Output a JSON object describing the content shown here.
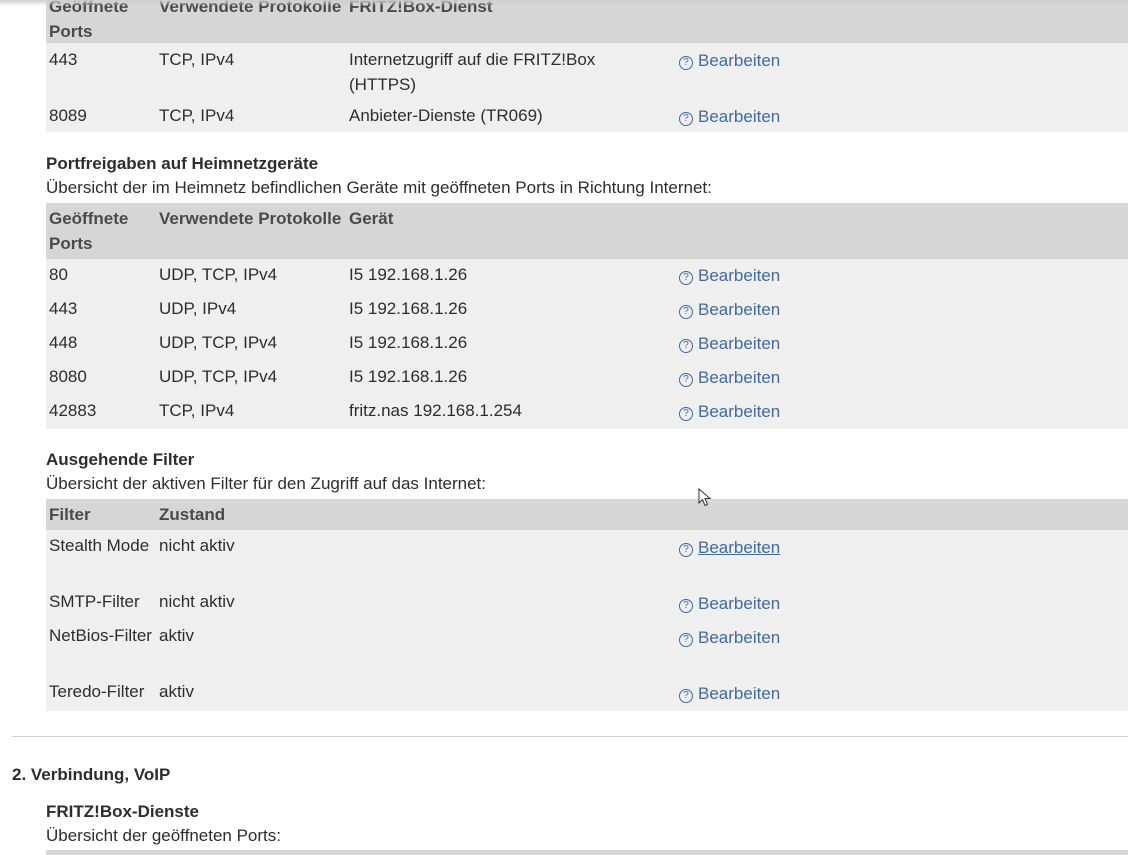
{
  "section1": {
    "fritzbox_services_table": {
      "headers": [
        "Geöffnete Ports",
        "Verwendete Protokolle",
        "FRITZ!Box-Dienst"
      ],
      "rows": [
        {
          "port": "443",
          "protocol": "TCP, IPv4",
          "service": "Internetzugriff auf die FRITZ!Box (HTTPS)",
          "action": "Bearbeiten"
        },
        {
          "port": "8089",
          "protocol": "TCP, IPv4",
          "service": "Anbieter-Dienste (TR069)",
          "action": "Bearbeiten"
        }
      ]
    },
    "portforwarding": {
      "title": "Portfreigaben auf Heimnetzgeräte",
      "description": "Übersicht der im Heimnetz befindlichen Geräte mit geöffneten Ports in Richtung Internet:",
      "headers": [
        "Geöffnete Ports",
        "Verwendete Protokolle",
        "Gerät"
      ],
      "rows": [
        {
          "port": "80",
          "protocol": "UDP, TCP, IPv4",
          "device": "I5 192.168.1.26",
          "action": "Bearbeiten"
        },
        {
          "port": "443",
          "protocol": "UDP, IPv4",
          "device": "I5 192.168.1.26",
          "action": "Bearbeiten"
        },
        {
          "port": "448",
          "protocol": "UDP, TCP, IPv4",
          "device": "I5 192.168.1.26",
          "action": "Bearbeiten"
        },
        {
          "port": "8080",
          "protocol": "UDP, TCP, IPv4",
          "device": "I5 192.168.1.26",
          "action": "Bearbeiten"
        },
        {
          "port": "42883",
          "protocol": "TCP, IPv4",
          "device": "fritz.nas 192.168.1.254",
          "action": "Bearbeiten"
        }
      ]
    },
    "outgoing_filters": {
      "title": "Ausgehende Filter",
      "description": "Übersicht der aktiven Filter für den Zugriff auf das Internet:",
      "headers": [
        "Filter",
        "Zustand"
      ],
      "rows": [
        {
          "filter": "Stealth Mode",
          "state": "nicht aktiv",
          "action": "Bearbeiten"
        },
        {
          "filter": "SMTP-Filter",
          "state": "nicht aktiv",
          "action": "Bearbeiten"
        },
        {
          "filter": "NetBios-Filter",
          "state": "aktiv",
          "action": "Bearbeiten"
        },
        {
          "filter": "Teredo-Filter",
          "state": "aktiv",
          "action": "Bearbeiten"
        }
      ]
    }
  },
  "section2": {
    "title": "2. Verbindung, VoIP",
    "fritzbox_services": {
      "title": "FRITZ!Box-Dienste",
      "description": "Übersicht der geöffneten Ports:"
    }
  },
  "icons": {
    "help": "question-circle-icon",
    "cursor": "mouse-pointer-icon"
  },
  "colors": {
    "link": "#3f6aa0",
    "header_bg": "#d6d6d6",
    "row_bg": "#efefef"
  }
}
